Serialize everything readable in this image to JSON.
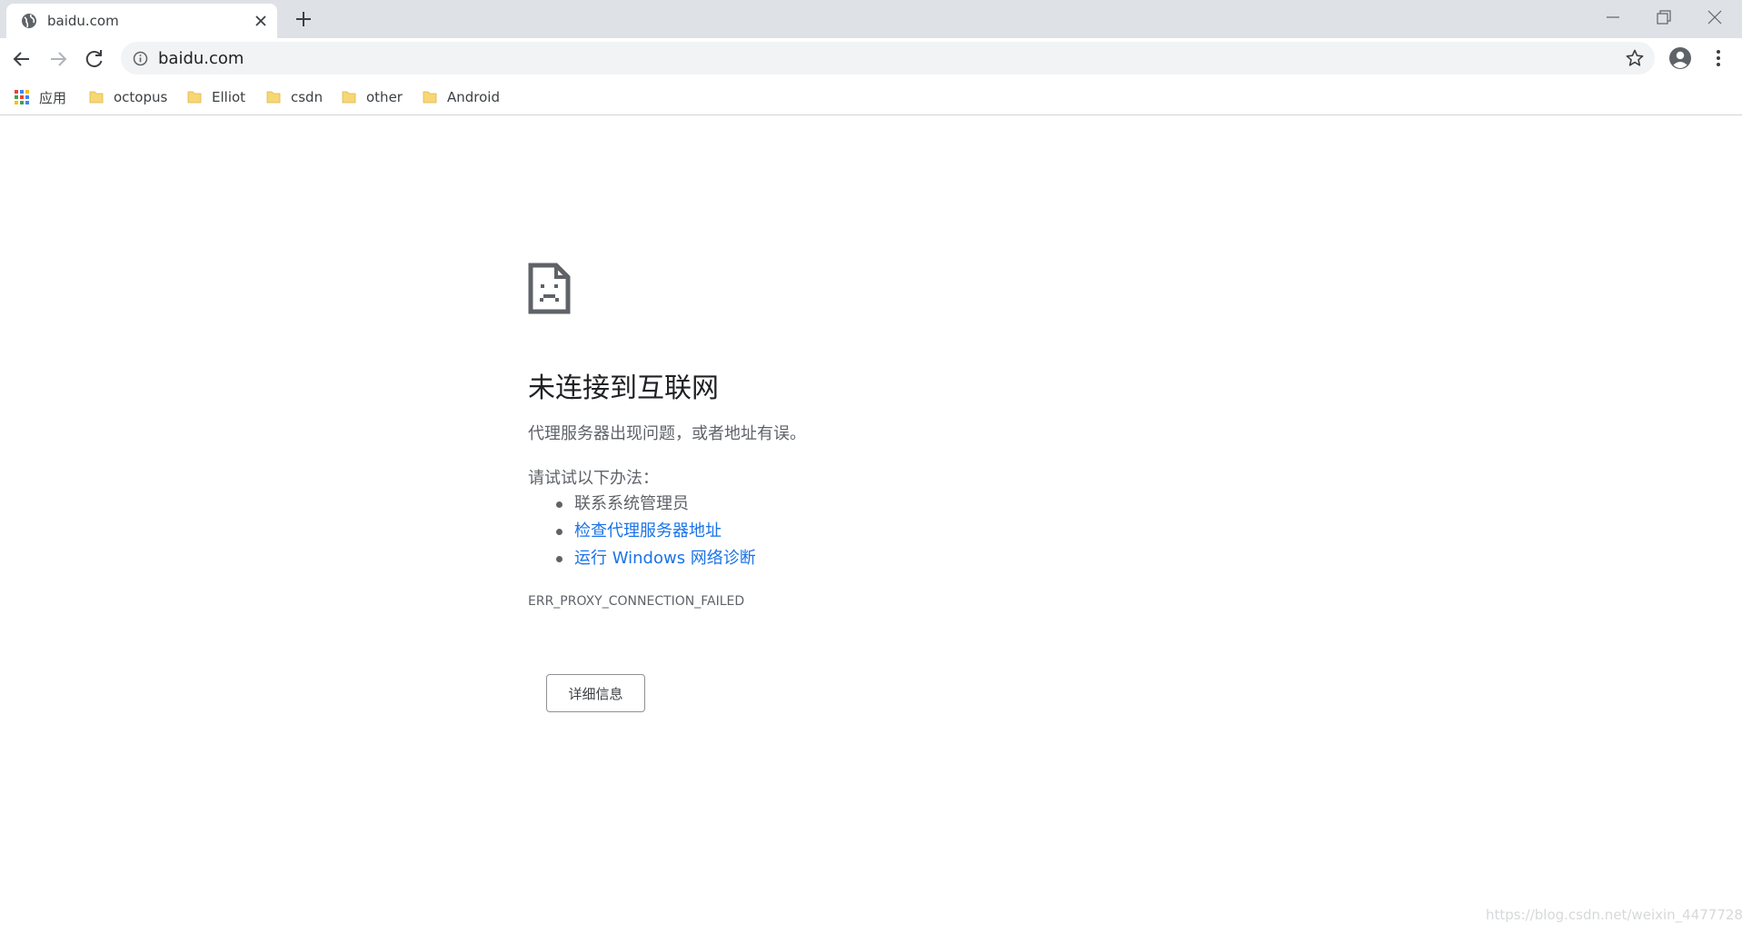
{
  "browser": {
    "tab": {
      "title": "baidu.com"
    },
    "address_bar": {
      "url": "baidu.com"
    },
    "bookmarks": [
      {
        "label": "应用",
        "icon": "apps-grid-icon"
      },
      {
        "label": "octopus",
        "icon": "folder-icon"
      },
      {
        "label": "Elliot",
        "icon": "folder-icon"
      },
      {
        "label": "csdn",
        "icon": "folder-icon"
      },
      {
        "label": "other",
        "icon": "folder-icon"
      },
      {
        "label": "Android",
        "icon": "folder-icon"
      }
    ]
  },
  "error_page": {
    "icon": "sad-document-icon",
    "title": "未连接到互联网",
    "description": "代理服务器出现问题，或者地址有误。",
    "try_heading": "请试试以下办法：",
    "suggestions": [
      {
        "text": "联系系统管理员"
      },
      {
        "text": "检查代理服务器地址"
      },
      {
        "text": "运行 Windows 网络诊断"
      }
    ],
    "error_code": "ERR_PROXY_CONNECTION_FAILED",
    "details_button": "详细信息"
  },
  "watermark": "https://blog.csdn.net/weixin_44777287",
  "colors": {
    "tab_strip": "#dee1e6",
    "link": "#1a73e8",
    "text_secondary": "#5f6368",
    "folder": "#f7d774"
  }
}
